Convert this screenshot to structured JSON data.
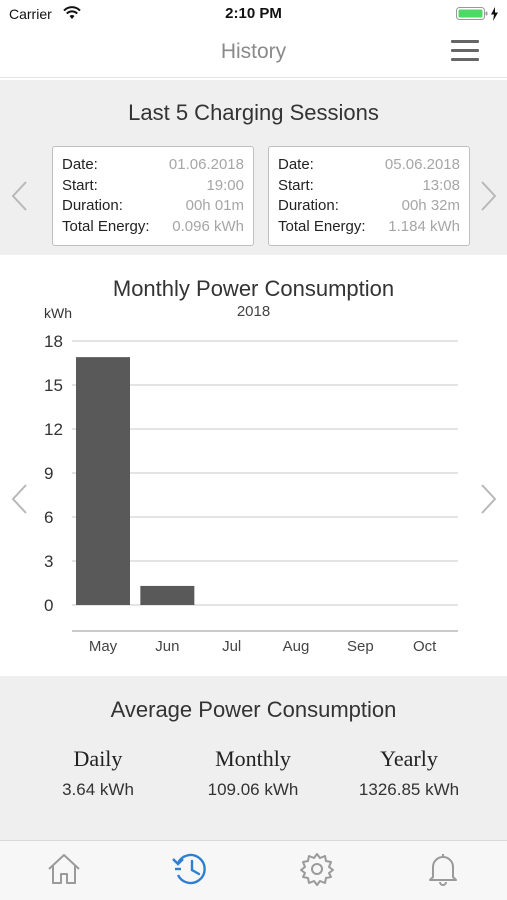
{
  "status_bar": {
    "carrier": "Carrier",
    "time": "2:10 PM",
    "wifi_icon": "wifi-icon",
    "battery_icon": "battery-charging-icon"
  },
  "nav": {
    "title": "History",
    "menu_icon": "hamburger-menu-icon"
  },
  "sessions": {
    "title": "Last 5 Charging Sessions",
    "cards": [
      {
        "date_label": "Date:",
        "date": "01.06.2018",
        "start_label": "Start:",
        "start": "19:00",
        "duration_label": "Duration:",
        "duration": "00h 01m",
        "energy_label": "Total Energy:",
        "energy": "0.096 kWh"
      },
      {
        "date_label": "Date:",
        "date": "05.06.2018",
        "start_label": "Start:",
        "start": "13:08",
        "duration_label": "Duration:",
        "duration": "00h 32m",
        "energy_label": "Total Energy:",
        "energy": "1.184 kWh"
      }
    ]
  },
  "chart_section": {
    "title": "Monthly Power Consumption",
    "year": "2018",
    "unit": "kWh"
  },
  "chart_data": {
    "type": "bar",
    "title": "Monthly Power Consumption",
    "subtitle": "2018",
    "ylabel": "kWh",
    "categories": [
      "May",
      "Jun",
      "Jul",
      "Aug",
      "Sep",
      "Oct"
    ],
    "values": [
      16.9,
      1.3,
      0,
      0,
      0,
      0
    ],
    "ylim": [
      0,
      18
    ],
    "yticks": [
      0,
      3,
      6,
      9,
      12,
      15,
      18
    ],
    "grid": true,
    "bar_color": "#595959"
  },
  "average": {
    "title": "Average Power Consumption",
    "daily_label": "Daily",
    "daily_value": "3.64 kWh",
    "monthly_label": "Monthly",
    "monthly_value": "109.06 kWh",
    "yearly_label": "Yearly",
    "yearly_value": "1326.85 kWh"
  },
  "tab_bar": {
    "tabs": [
      {
        "icon": "home-icon",
        "active": false
      },
      {
        "icon": "history-icon",
        "active": true
      },
      {
        "icon": "gear-icon",
        "active": false
      },
      {
        "icon": "bell-icon",
        "active": false
      }
    ]
  },
  "colors": {
    "accent": "#2d7fd3",
    "inactive_icon": "#9a9a9a",
    "section_bg": "#efefef"
  }
}
